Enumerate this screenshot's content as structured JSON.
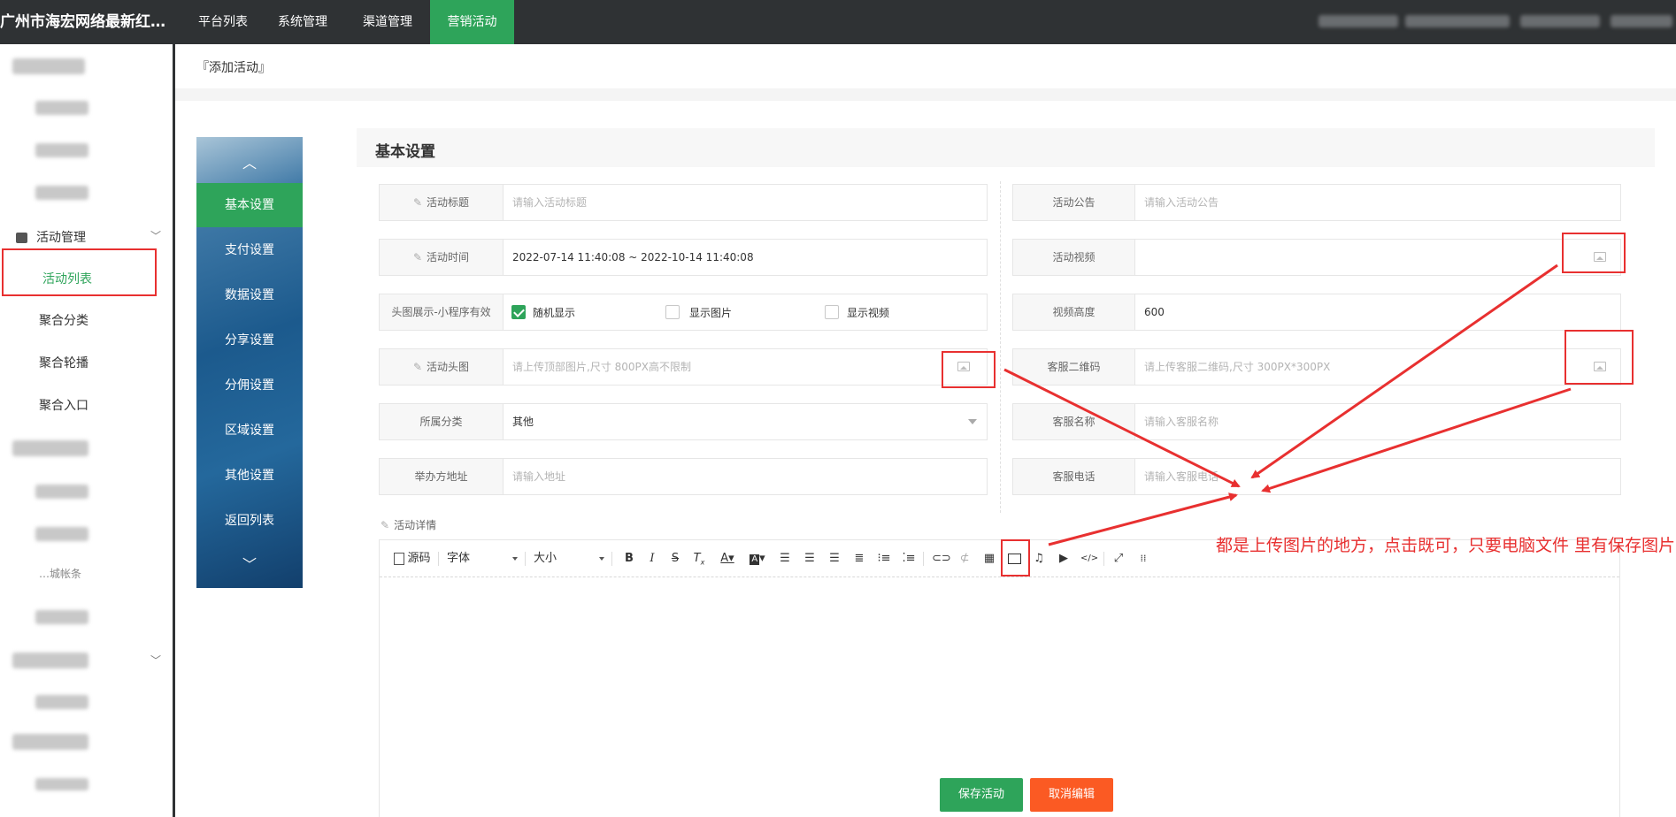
{
  "app": {
    "title": "广州市海宏网络最新红…"
  },
  "top_nav": [
    "平台列表",
    "系统管理",
    "渠道管理",
    "营销活动"
  ],
  "top_nav_active": "营销活动",
  "sidebar": {
    "group_label": "活动管理",
    "active_item": "活动列表",
    "items": [
      "聚合分类",
      "聚合轮播",
      "聚合入口"
    ],
    "partial_text": "…城帐条"
  },
  "breadcrumb": "『添加活动』",
  "vertical_tabs": [
    "基本设置",
    "支付设置",
    "数据设置",
    "分享设置",
    "分佣设置",
    "区域设置",
    "其他设置",
    "返回列表"
  ],
  "vertical_tabs_active": "基本设置",
  "section_title": "基本设置",
  "form_left": {
    "title_label": "活动标题",
    "title_placeholder": "请输入活动标题",
    "time_label": "活动时间",
    "time_value": "2022-07-14 11:40:08 ~ 2022-10-14 11:40:08",
    "display_label": "头图展示-小程序有效",
    "options": [
      {
        "label": "随机显示",
        "checked": true
      },
      {
        "label": "显示图片",
        "checked": false
      },
      {
        "label": "显示视频",
        "checked": false
      }
    ],
    "headimg_label": "活动头图",
    "headimg_placeholder": "请上传顶部图片,尺寸 800PX高不限制",
    "category_label": "所属分类",
    "category_value": "其他",
    "address_label": "举办方地址",
    "address_placeholder": "请输入地址"
  },
  "form_right": {
    "notice_label": "活动公告",
    "notice_placeholder": "请输入活动公告",
    "video_label": "活动视频",
    "video_height_label": "视频高度",
    "video_height_value": "600",
    "qrcode_label": "客服二维码",
    "qrcode_placeholder": "请上传客服二维码,尺寸 300PX*300PX",
    "cs_name_label": "客服名称",
    "cs_name_placeholder": "请输入客服名称",
    "cs_phone_label": "客服电话",
    "cs_phone_placeholder": "请输入客服电话"
  },
  "editor": {
    "label": "活动详情",
    "source_label": "源码",
    "font_label": "字体",
    "size_label": "大小"
  },
  "buttons": {
    "save": "保存活动",
    "cancel": "取消编辑"
  },
  "annotation": "都是上传图片的地方，点击既可，只要电脑文件 里有保存图片",
  "colors": {
    "topbar": "#2f3234",
    "accent": "#2ea45a",
    "cancel": "#fb5a23",
    "annotation": "#e83030"
  }
}
